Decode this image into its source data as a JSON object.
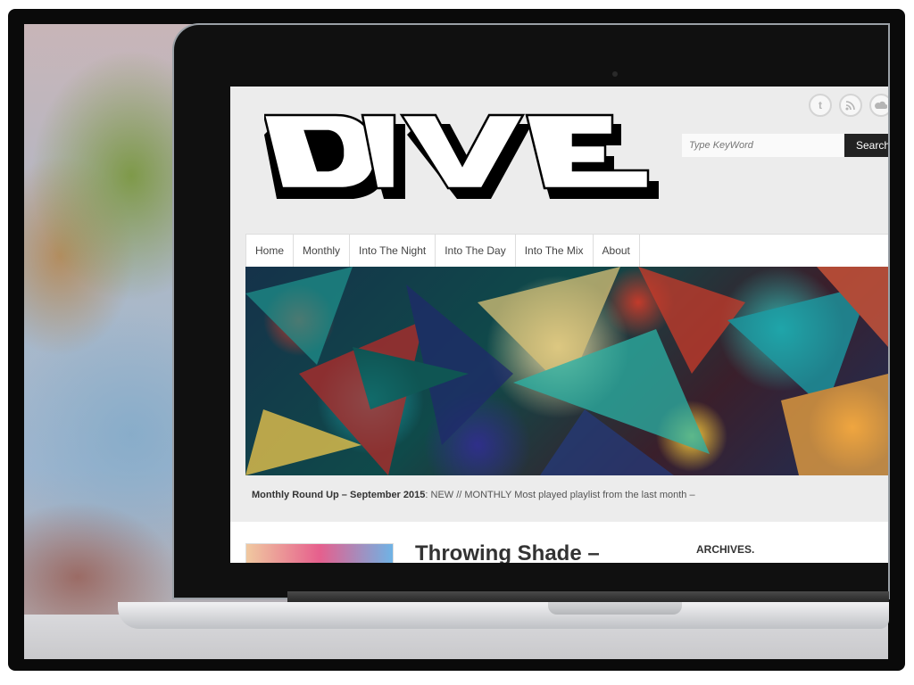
{
  "site": {
    "logo_text": "DIVE",
    "search": {
      "placeholder": "Type KeyWord",
      "button_label": "Search"
    },
    "social_icons": [
      "twitter-icon",
      "rss-icon",
      "soundcloud-icon"
    ],
    "nav": [
      "Home",
      "Monthly",
      "Into The Night",
      "Into The Day",
      "Into The Mix",
      "About"
    ],
    "featured_caption": {
      "title": "Monthly Round Up – September 2015",
      "text": "NEW // MONTHLY Most played playlist from the last month –"
    },
    "post_title": "Throwing Shade –",
    "sidebar_heading": "ARCHIVES."
  }
}
